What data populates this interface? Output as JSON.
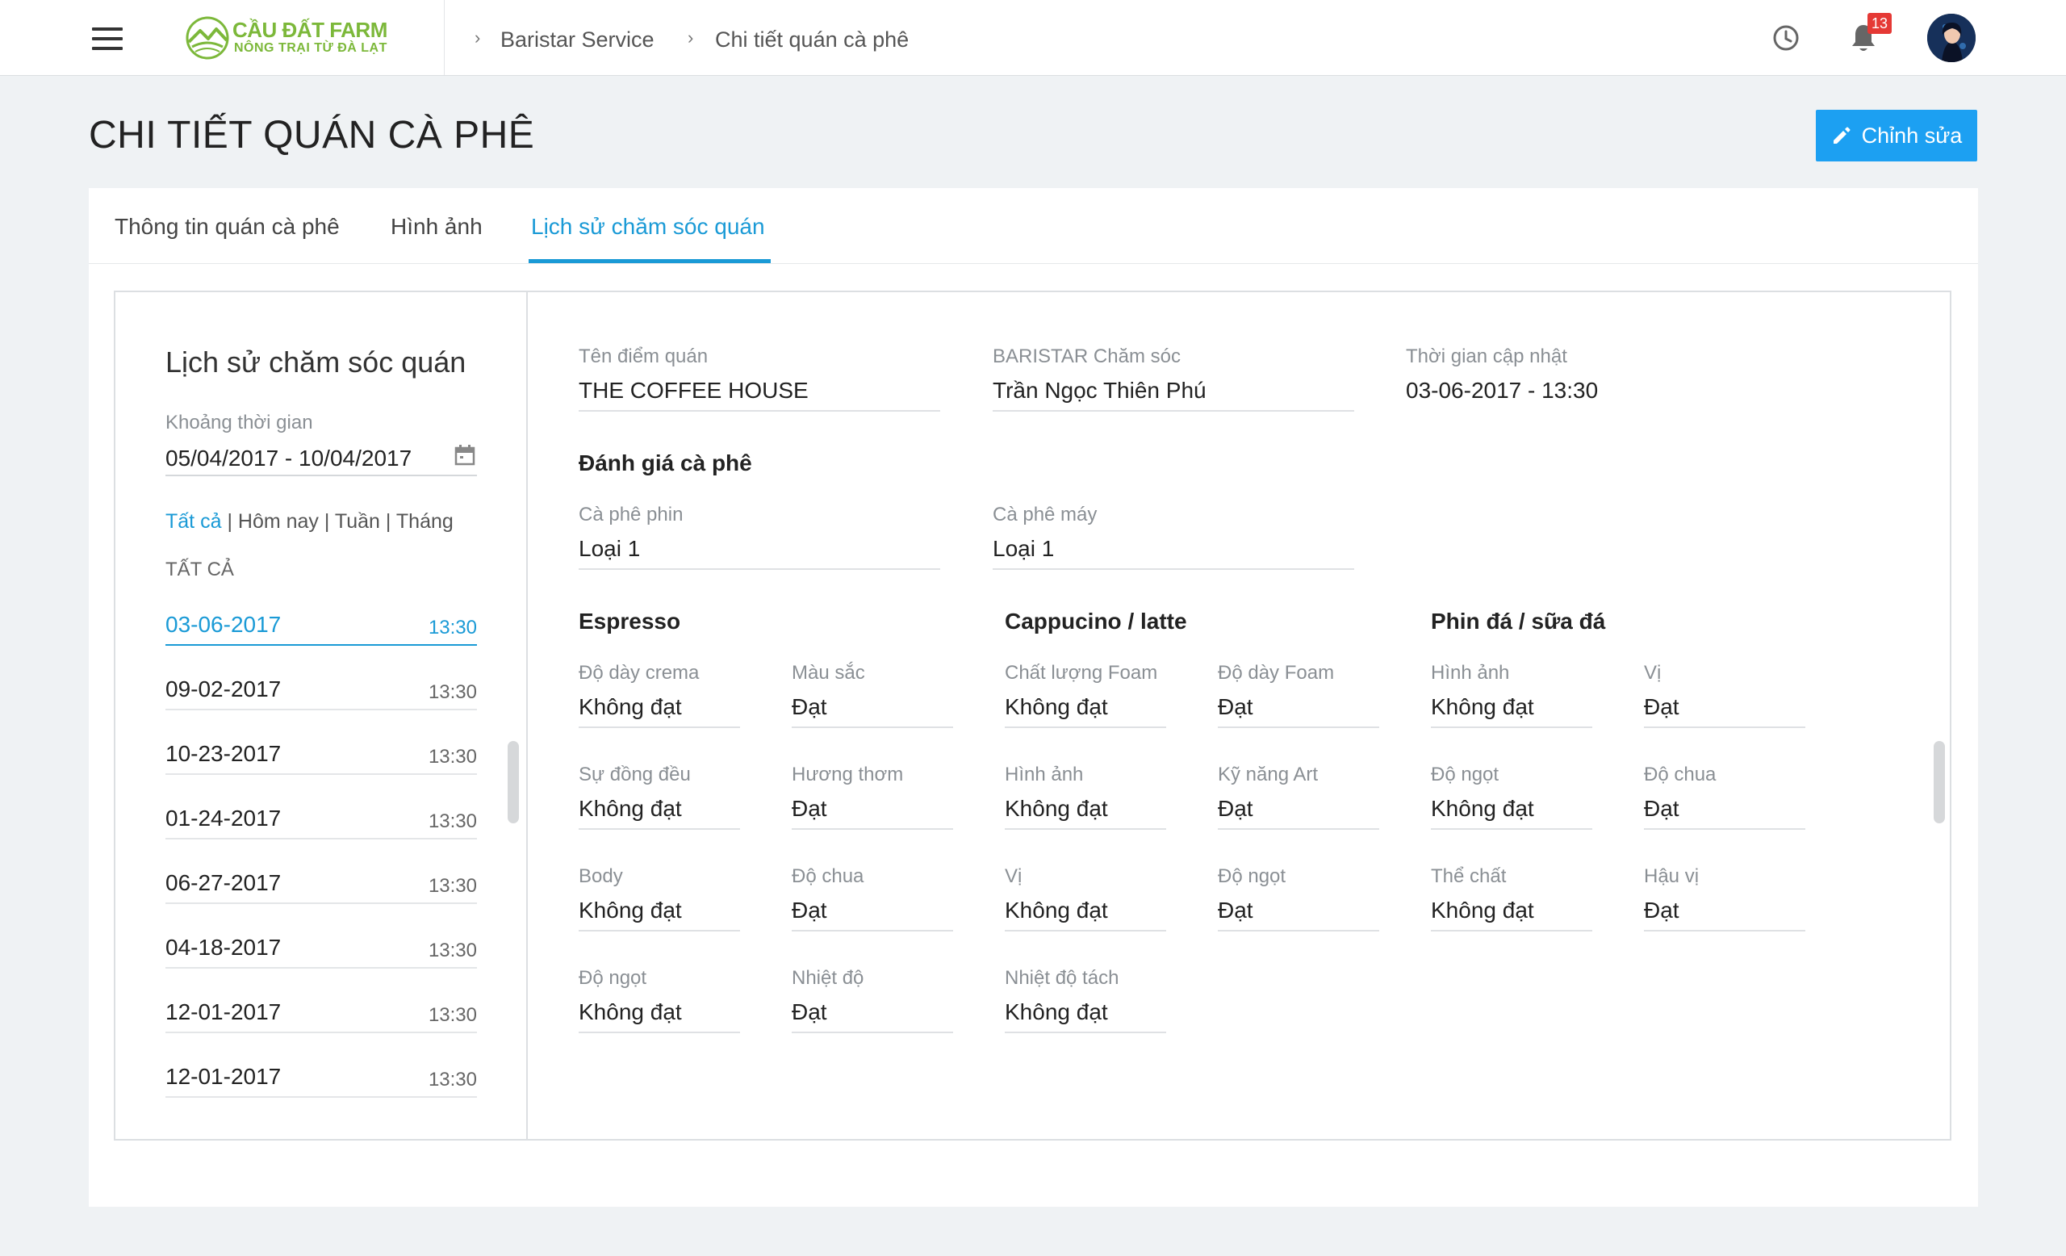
{
  "topbar": {
    "logo_line1": "CẦU ĐẤT FARM",
    "logo_line2": "NÔNG TRẠI TỪ ĐÀ LẠT",
    "breadcrumb": [
      "Baristar Service",
      "Chi tiết quán cà phê"
    ],
    "notification_count": "13"
  },
  "page": {
    "title": "CHI TIẾT QUÁN CÀ PHÊ",
    "edit_label": "Chỉnh sửa"
  },
  "tabs": [
    {
      "label": "Thông tin quán cà phê"
    },
    {
      "label": "Hình ảnh"
    },
    {
      "label": "Lịch sử chăm sóc quán",
      "active": true
    }
  ],
  "history": {
    "title": "Lịch sử chăm sóc quán",
    "range_label": "Khoảng thời gian",
    "range_value": "05/04/2017 - 10/04/2017",
    "filters": [
      "Tất cả",
      "Hôm nay",
      "Tuần",
      "Tháng"
    ],
    "active_filter": "Tất cả",
    "list_header": "TẤT CẢ",
    "rows": [
      {
        "date": "03-06-2017",
        "time": "13:30",
        "active": true
      },
      {
        "date": "09-02-2017",
        "time": "13:30"
      },
      {
        "date": "10-23-2017",
        "time": "13:30"
      },
      {
        "date": "01-24-2017",
        "time": "13:30"
      },
      {
        "date": "06-27-2017",
        "time": "13:30"
      },
      {
        "date": "04-18-2017",
        "time": "13:30"
      },
      {
        "date": "12-01-2017",
        "time": "13:30"
      },
      {
        "date": "12-01-2017",
        "time": "13:30"
      }
    ]
  },
  "detail": {
    "store_name": {
      "label": "Tên điểm quán",
      "value": "THE COFFEE HOUSE"
    },
    "barista": {
      "label": "BARISTAR Chăm sóc",
      "value": "Trần Ngọc Thiên Phú"
    },
    "updated": {
      "label": "Thời gian cập nhật",
      "value": "03-06-2017 - 13:30"
    },
    "rating_title": "Đánh giá cà phê",
    "phin": {
      "label": "Cà phê phin",
      "value": "Loại 1"
    },
    "machine": {
      "label": "Cà phê máy",
      "value": "Loại 1"
    },
    "groups": [
      {
        "title": "Espresso",
        "fields": [
          {
            "label": "Độ dày crema",
            "value": "Không đạt"
          },
          {
            "label": "Màu sắc",
            "value": "Đạt"
          },
          {
            "label": "Sự đồng đều",
            "value": "Không đạt"
          },
          {
            "label": "Hương thơm",
            "value": "Đạt"
          },
          {
            "label": "Body",
            "value": "Không đạt"
          },
          {
            "label": "Độ chua",
            "value": "Đạt"
          },
          {
            "label": "Độ ngọt",
            "value": "Không đạt"
          },
          {
            "label": "Nhiệt độ",
            "value": "Đạt"
          }
        ]
      },
      {
        "title": "Cappucino / latte",
        "fields": [
          {
            "label": "Chất lượng Foam",
            "value": "Không đạt"
          },
          {
            "label": "Độ dày Foam",
            "value": "Đạt"
          },
          {
            "label": "Hình ảnh",
            "value": "Không đạt"
          },
          {
            "label": "Kỹ năng Art",
            "value": "Đạt"
          },
          {
            "label": "Vị",
            "value": "Không đạt"
          },
          {
            "label": "Độ ngọt",
            "value": "Đạt"
          },
          {
            "label": "Nhiệt độ tách",
            "value": "Không đạt"
          }
        ]
      },
      {
        "title": "Phin đá / sữa đá",
        "fields": [
          {
            "label": "Hình ảnh",
            "value": "Không đạt"
          },
          {
            "label": "Vị",
            "value": "Đạt"
          },
          {
            "label": "Độ ngọt",
            "value": "Không đạt"
          },
          {
            "label": "Độ chua",
            "value": "Đạt"
          },
          {
            "label": "Thể chất",
            "value": "Không đạt"
          },
          {
            "label": "Hậu vị",
            "value": "Đạt"
          }
        ]
      }
    ]
  },
  "colors": {
    "accent": "#1a9ad6",
    "button": "#1ca0f2",
    "brand": "#7cb83a",
    "badge": "#e53935"
  },
  "icons": [
    "menu-icon",
    "clock-icon",
    "bell-icon",
    "calendar-icon",
    "pencil-icon"
  ]
}
